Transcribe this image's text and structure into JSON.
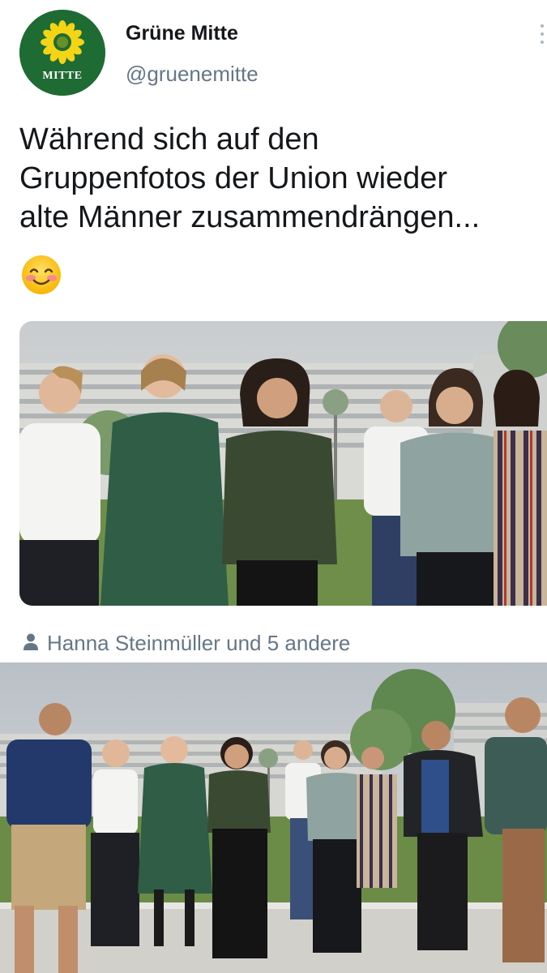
{
  "account": {
    "display_name": "Grüne Mitte",
    "handle": "@gruenemitte",
    "avatar_text": "MITTE",
    "avatar_icon": "sunflower-icon"
  },
  "tweet": {
    "text": "Während sich auf den\nGruppenfotos der Union wieder\nalte Männer zusammendrängen...",
    "emoji": "smiling-face-icon"
  },
  "photo_tag": {
    "icon": "person-icon",
    "text": "Hanna Steinmüller und 5 andere"
  },
  "colors": {
    "avatar_green": "#1f6b34",
    "sunflower_yellow": "#f3d515",
    "secondary_text": "#657786",
    "primary_text": "#14171a"
  }
}
